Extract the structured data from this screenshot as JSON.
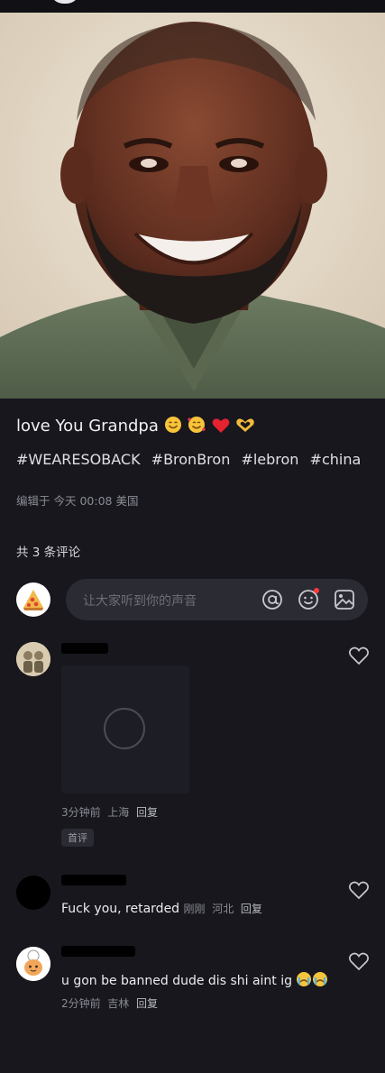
{
  "post": {
    "caption": "love You Grandpa",
    "caption_emojis": [
      "smiling-face-icon",
      "smiling-face-with-hearts-icon",
      "red-heart-icon",
      "heart-hands-icon"
    ],
    "tags": [
      "#WEARESOBACK",
      "#BronBron",
      "#lebron",
      "#china"
    ],
    "edited_label": "编辑于",
    "edited_time": "今天 00:08",
    "edited_location": "美国"
  },
  "comments_section": {
    "count_label": "共 3 条评论",
    "input_placeholder": "让大家听到你的声音",
    "input_icons": [
      "at-icon",
      "emoji-icon",
      "image-icon"
    ]
  },
  "comments": [
    {
      "text": "",
      "time": "3分钟前",
      "location": "上海",
      "reply_label": "回复",
      "badge": "首评",
      "has_image": true
    },
    {
      "text": "Fuck you, retarded",
      "time": "刚刚",
      "location": "河北",
      "reply_label": "回复"
    },
    {
      "text": "u gon be banned dude dis shi aint ig",
      "text_emojis": [
        "crying-face-icon",
        "crying-face-icon"
      ],
      "time": "2分钟前",
      "location": "吉林",
      "reply_label": "回复"
    }
  ],
  "colors": {
    "background": "#17171d",
    "input_bg": "#2a2b33",
    "muted_text": "#8a8b94",
    "notification_dot": "#ff3b3b"
  }
}
